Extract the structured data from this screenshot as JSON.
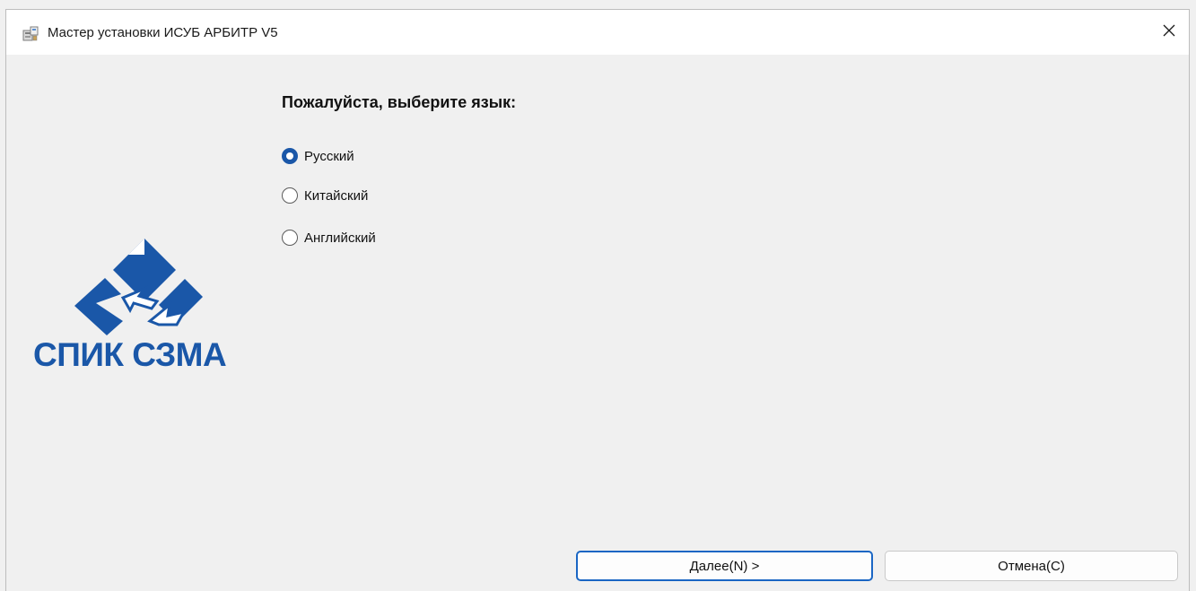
{
  "window": {
    "title": "Мастер установки ИСУБ АРБИТР V5",
    "app_icon": "installer-icon",
    "close_icon": "close-icon"
  },
  "logo": {
    "text": "СПИК СЗМА",
    "brand_color": "#1a57a8"
  },
  "main": {
    "prompt": "Пожалуйста, выберите язык:",
    "languages": [
      {
        "label": "Русский",
        "selected": true
      },
      {
        "label": "Китайский",
        "selected": false
      },
      {
        "label": "Английский",
        "selected": false
      }
    ]
  },
  "buttons": {
    "next_label": "Далее(N) >",
    "cancel_label": "Отмена(C)"
  },
  "colors": {
    "accent": "#1a66c4",
    "radio_selected": "#1a57a8",
    "background": "#f0f0f0"
  }
}
